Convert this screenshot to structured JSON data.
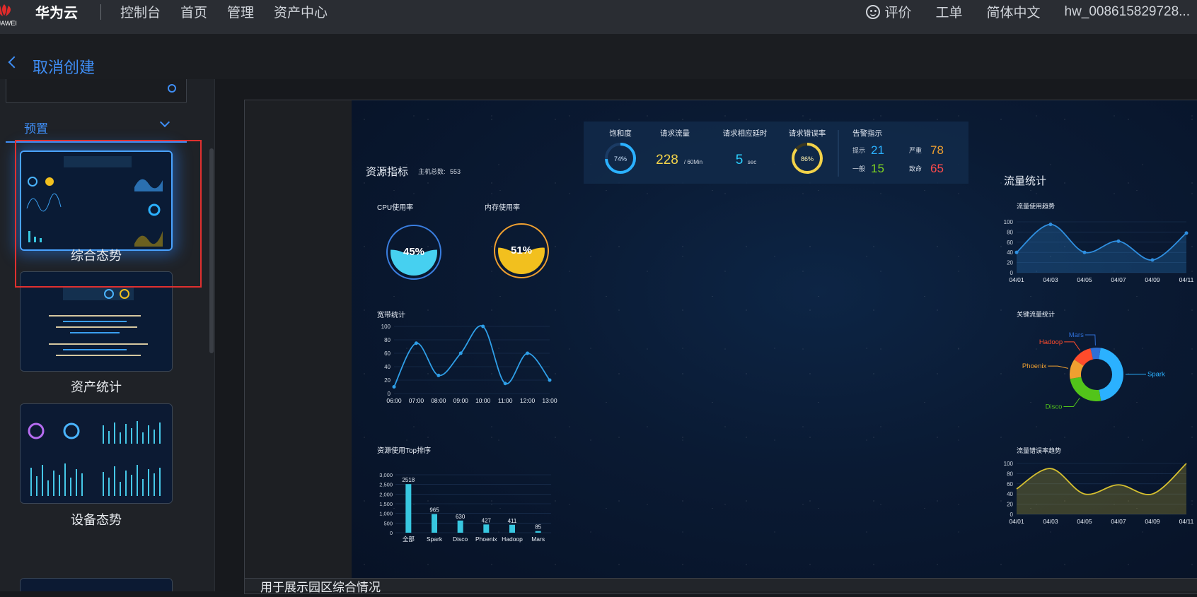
{
  "topbar": {
    "brand": "华为云",
    "logo_text": "HUAWEI",
    "nav": [
      "控制台",
      "首页",
      "管理",
      "资产中心"
    ],
    "right": {
      "feedback": "评价",
      "ticket": "工单",
      "language": "简体中文",
      "account": "hw_008615829728..."
    }
  },
  "back": {
    "label": "取消创建"
  },
  "sidebar": {
    "search": {
      "value": ""
    },
    "category": {
      "label": "预置"
    },
    "templates": [
      {
        "label": "综合态势",
        "selected": true
      },
      {
        "label": "资产统计",
        "selected": false
      },
      {
        "label": "设备态势",
        "selected": false
      }
    ]
  },
  "bottom_caption": "用于展示园区综合情况",
  "dashboard": {
    "kpis": {
      "saturation": {
        "label": "饱和度",
        "value": "74%"
      },
      "requests": {
        "label": "请求流量",
        "value": "228",
        "unit": "/ 60Min"
      },
      "latency": {
        "label": "请求相应延时",
        "value": "5",
        "unit": "sec"
      },
      "error_rate": {
        "label": "请求错误率",
        "value": "86%"
      },
      "alerts": {
        "label": "告警指示",
        "items": [
          {
            "name": "提示",
            "value": "21",
            "color": "#2bb1ff"
          },
          {
            "name": "严重",
            "value": "78",
            "color": "#f0a030"
          },
          {
            "name": "一般",
            "value": "15",
            "color": "#7ed321"
          },
          {
            "name": "致命",
            "value": "65",
            "color": "#ff4b4b"
          }
        ]
      }
    },
    "resource": {
      "title": "资源指标",
      "host_total_label": "主机总数:",
      "host_total": "553",
      "cpu": {
        "label": "CPU使用率",
        "value": "45%",
        "fill": 0.45
      },
      "memory": {
        "label": "内存使用率",
        "value": "51%",
        "fill": 0.51
      }
    },
    "flow": {
      "title": "流量统计",
      "trend_title": "流量使用趋势",
      "key_title": "关键流量统计",
      "error_title": "流量错误率趋势"
    }
  },
  "chart_data": [
    {
      "type": "line",
      "title": "宽带统计",
      "x": [
        "06:00",
        "07:00",
        "08:00",
        "09:00",
        "10:00",
        "11:00",
        "12:00",
        "13:00"
      ],
      "values": [
        10,
        75,
        27,
        60,
        100,
        15,
        60,
        20
      ],
      "ylim": [
        0,
        100
      ],
      "yticks": [
        "0",
        "20",
        "40",
        "60",
        "80",
        "100"
      ]
    },
    {
      "type": "bar",
      "title": "资源使用Top排序",
      "categories": [
        "全部",
        "Spark",
        "Disco",
        "Phoenix",
        "Hadoop",
        "Mars"
      ],
      "values": [
        2518,
        965,
        630,
        427,
        411,
        85
      ],
      "ylim": [
        0,
        3000
      ],
      "yticks": [
        "0",
        "500",
        "1,000",
        "1,500",
        "2,000",
        "2,500",
        "3,000"
      ]
    },
    {
      "type": "area",
      "title": "流量使用趋势",
      "x": [
        "04/01",
        "04/03",
        "04/05",
        "04/07",
        "04/09",
        "04/11"
      ],
      "values": [
        40,
        95,
        40,
        62,
        25,
        78
      ],
      "ylim": [
        0,
        100
      ],
      "yticks": [
        "0",
        "20",
        "40",
        "60",
        "80",
        "100"
      ],
      "color": "#2f8fe0"
    },
    {
      "type": "pie",
      "title": "关键流量统计",
      "categories": [
        "Spark",
        "Disco",
        "Phoenix",
        "Hadoop",
        "Mars"
      ],
      "values": [
        45,
        25,
        12,
        12,
        6
      ],
      "colors": [
        "#2bb1ff",
        "#52c41a",
        "#f0a030",
        "#ff4b2b",
        "#2f6fd6"
      ]
    },
    {
      "type": "area",
      "title": "流量错误率趋势",
      "x": [
        "04/01",
        "04/03",
        "04/05",
        "04/07",
        "04/09",
        "04/11"
      ],
      "values": [
        50,
        90,
        40,
        58,
        40,
        100
      ],
      "ylim": [
        0,
        100
      ],
      "yticks": [
        "0",
        "20",
        "40",
        "60",
        "80",
        "100"
      ],
      "color": "#d6c030"
    }
  ]
}
